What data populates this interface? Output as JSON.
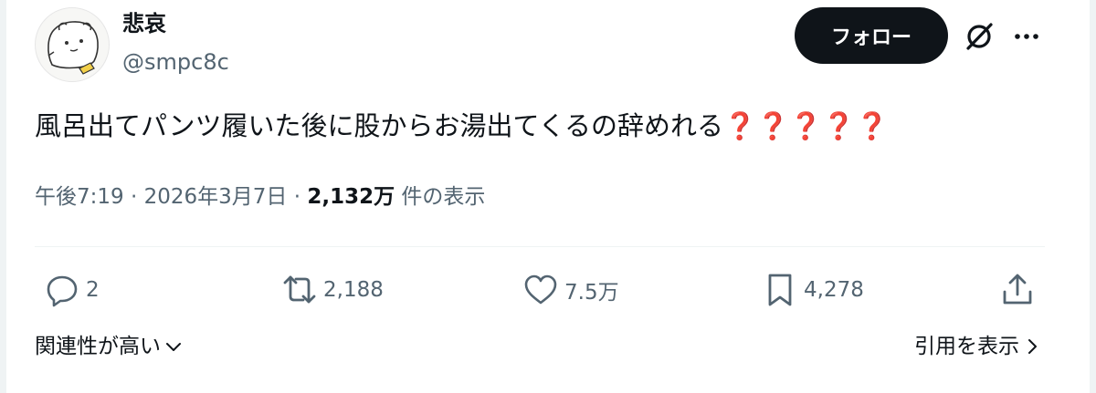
{
  "author": {
    "display_name": "悲哀",
    "handle": "@smpc8c"
  },
  "header": {
    "follow_label": "フォロー",
    "icons": [
      "grok-icon",
      "more-icon"
    ]
  },
  "tweet": {
    "text": "風呂出てパンツ履いた後に股からお湯出てくるの辞めれる",
    "emoji": "❓❓❓❓❓"
  },
  "meta": {
    "time": "午後7:19",
    "separator": "·",
    "date": "2026年3月7日",
    "views_count": "2,132万",
    "views_label": "件の表示"
  },
  "actions": {
    "replies": "2",
    "reposts": "2,188",
    "likes": "7.5万",
    "bookmarks": "4,278"
  },
  "footer": {
    "sort_label": "関連性が高い",
    "quotes_label": "引用を表示"
  },
  "colors": {
    "text": "#0f1419",
    "secondary": "#536471",
    "button_bg": "#0f1419",
    "emoji": "#b81e2a"
  }
}
